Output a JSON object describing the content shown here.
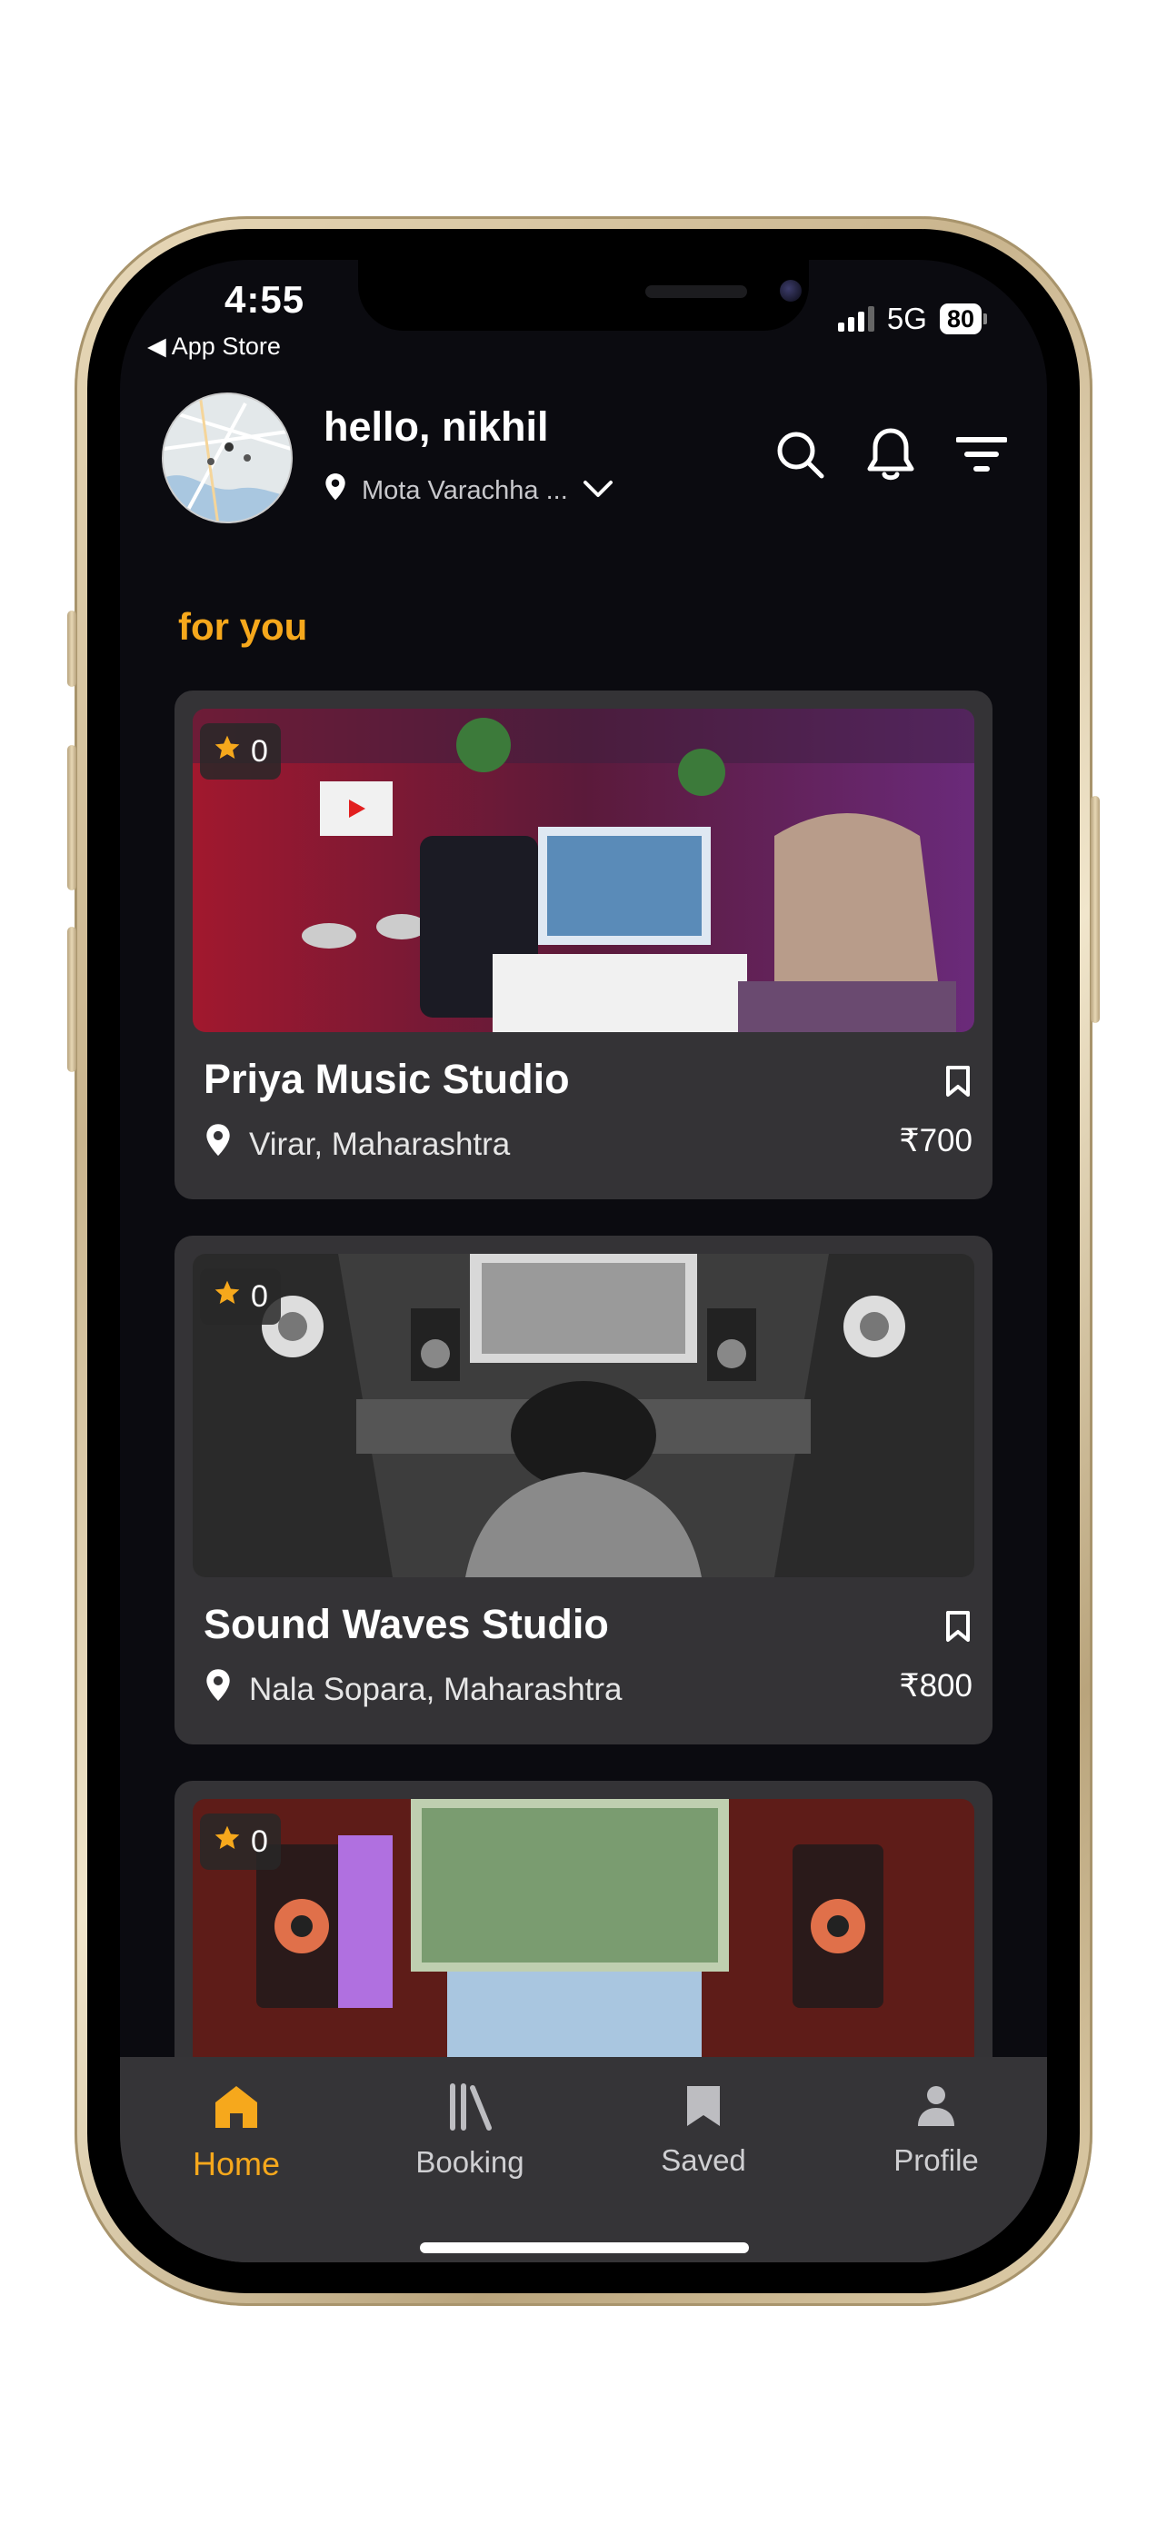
{
  "status_bar": {
    "time": "4:55",
    "back_app": "App Store",
    "network": "5G",
    "battery": "80"
  },
  "header": {
    "greeting": "hello, nikhil",
    "location": "Mota Varachha ...",
    "icons": [
      "search-icon",
      "bell-icon",
      "filter-icon"
    ]
  },
  "section": {
    "title": "for you"
  },
  "studios": [
    {
      "name": "Priya Music Studio",
      "location": "Virar, Maharashtra",
      "price": "₹700",
      "rating": "0"
    },
    {
      "name": "Sound Waves Studio",
      "location": "Nala Sopara, Maharashtra",
      "price": "₹800",
      "rating": "0"
    },
    {
      "name": "",
      "location": "",
      "price": "",
      "rating": "0"
    }
  ],
  "tabbar": {
    "items": [
      {
        "label": "Home",
        "icon": "home-icon",
        "active": true
      },
      {
        "label": "Booking",
        "icon": "library-icon",
        "active": false
      },
      {
        "label": "Saved",
        "icon": "bookmark-icon",
        "active": false
      },
      {
        "label": "Profile",
        "icon": "person-icon",
        "active": false
      }
    ]
  },
  "colors": {
    "accent": "#f6a81c",
    "background": "#0b0b10",
    "card": "#343336",
    "tabbar": "#353437"
  }
}
